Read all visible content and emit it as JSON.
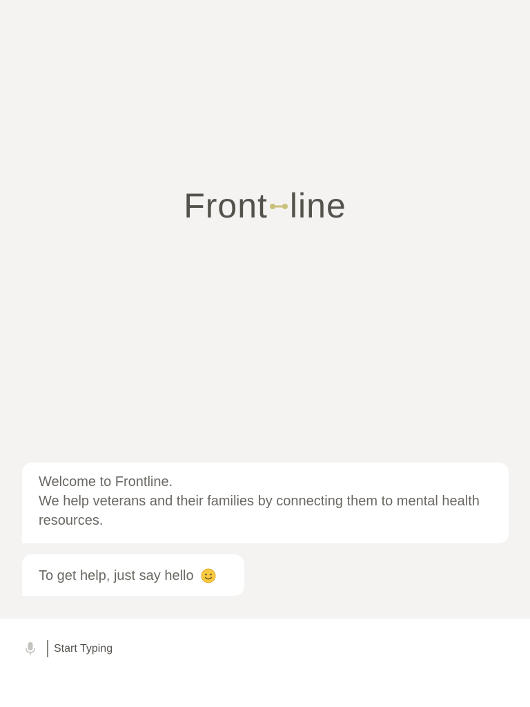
{
  "logo": {
    "text_left": "Front",
    "text_right": "line",
    "mark_icon": "dumbbell-link-icon",
    "mark_color": "#c9c07a"
  },
  "messages": [
    {
      "line1": "Welcome to Frontline.",
      "line2": "We help veterans and their families by connecting them to mental health resources."
    },
    {
      "text": "To get help, just say hello",
      "emoji_icon": "smiling-face-icon"
    }
  ],
  "composer": {
    "mic_icon": "microphone-icon",
    "placeholder": "Start Typing"
  },
  "colors": {
    "background": "#f4f3f1",
    "bubble": "#ffffff",
    "text": "#6b6863",
    "accent": "#c9c07a"
  }
}
